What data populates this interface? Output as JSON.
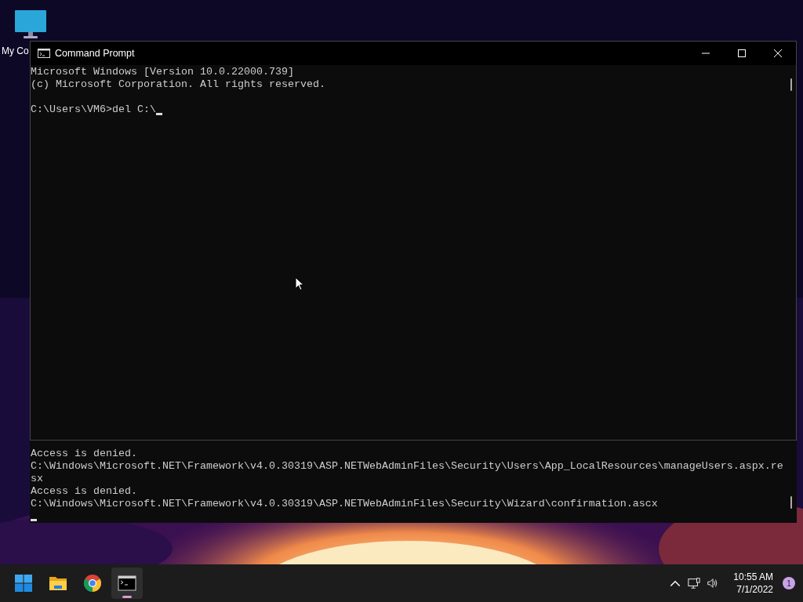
{
  "desktop": {
    "icons": [
      {
        "label": "My Co"
      }
    ]
  },
  "back_window": {
    "lines": [
      "Access is denied.",
      "C:\\Windows\\Microsoft.NET\\Framework\\v4.0.30319\\ASP.NETWebAdminFiles\\Security\\Users\\App_LocalResources\\manageUsers.aspx.re",
      "sx",
      "Access is denied.",
      "C:\\Windows\\Microsoft.NET\\Framework\\v4.0.30319\\ASP.NETWebAdminFiles\\Security\\Wizard\\confirmation.ascx"
    ]
  },
  "front_window": {
    "title": "Command Prompt",
    "banner": [
      "Microsoft Windows [Version 10.0.22000.739]",
      "(c) Microsoft Corporation. All rights reserved."
    ],
    "prompt": "C:\\Users\\VM6>del C:\\"
  },
  "taskbar": {
    "apps": [
      {
        "kind": "start",
        "active": false
      },
      {
        "kind": "explorer",
        "active": false
      },
      {
        "kind": "chrome",
        "active": false
      },
      {
        "kind": "terminal",
        "active": true
      }
    ],
    "clock": {
      "time": "10:55 AM",
      "date": "7/1/2022"
    },
    "notifications": "1"
  }
}
